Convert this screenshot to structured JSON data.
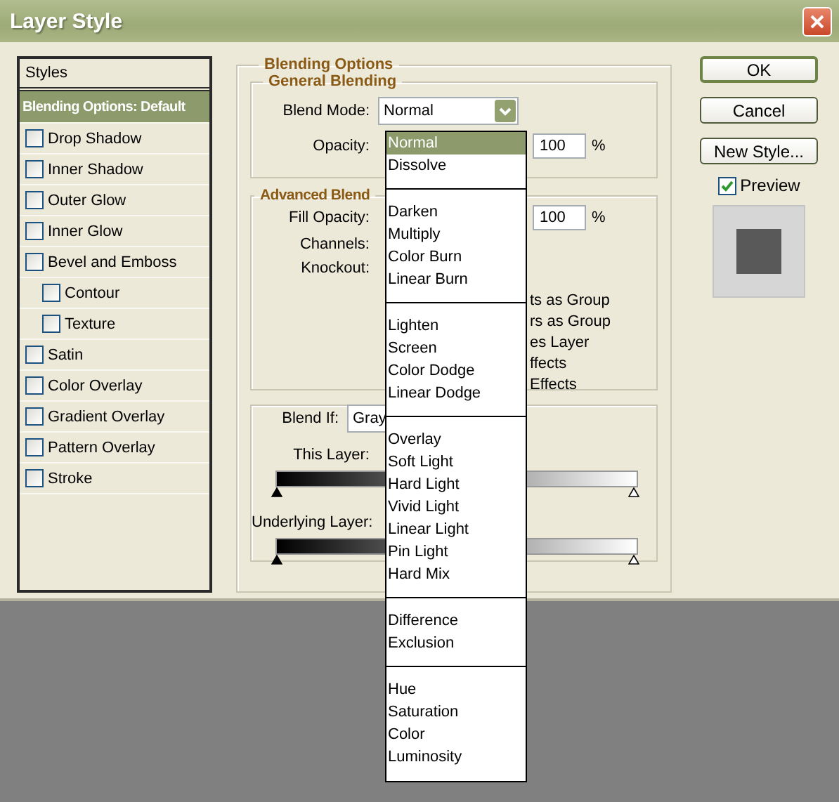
{
  "window": {
    "title": "Layer Style"
  },
  "styles_list": {
    "header": "Styles",
    "items": [
      {
        "label": "Blending Options: Default",
        "kind": "heading",
        "selected": true
      },
      {
        "label": "Drop Shadow",
        "kind": "checkbox",
        "checked": false,
        "selected": false
      },
      {
        "label": "Inner Shadow",
        "kind": "checkbox",
        "checked": false,
        "selected": false
      },
      {
        "label": "Outer Glow",
        "kind": "checkbox",
        "checked": false,
        "selected": false
      },
      {
        "label": "Inner Glow",
        "kind": "checkbox",
        "checked": false,
        "selected": false
      },
      {
        "label": "Bevel and Emboss",
        "kind": "checkbox",
        "checked": false,
        "selected": false,
        "children": [
          {
            "label": "Contour",
            "kind": "checkbox",
            "checked": false,
            "selected": false
          },
          {
            "label": "Texture",
            "kind": "checkbox",
            "checked": false,
            "selected": false
          }
        ]
      },
      {
        "label": "Satin",
        "kind": "checkbox",
        "checked": false,
        "selected": false
      },
      {
        "label": "Color Overlay",
        "kind": "checkbox",
        "checked": false,
        "selected": false
      },
      {
        "label": "Gradient Overlay",
        "kind": "checkbox",
        "checked": false,
        "selected": false
      },
      {
        "label": "Pattern Overlay",
        "kind": "checkbox",
        "checked": false,
        "selected": false
      },
      {
        "label": "Stroke",
        "kind": "checkbox",
        "checked": false,
        "selected": false
      }
    ]
  },
  "blending_options": {
    "title": "Blending Options",
    "general": {
      "title": "General Blending",
      "blend_mode_label": "Blend Mode:",
      "blend_mode": "Normal",
      "opacity_label": "Opacity:",
      "opacity": "100",
      "unit": "%"
    },
    "advanced": {
      "title": "Advanced Blend",
      "fill_opacity_label": "Fill Opacity:",
      "fill_opacity": "100",
      "unit": "%",
      "channels_label": "Channels:",
      "knockout_label": "Knockout:",
      "partial_options": [
        "ts as Group",
        "rs as Group",
        "es Layer",
        "ffects",
        "Effects"
      ]
    },
    "blend_if": {
      "label": "Blend If:",
      "channel": "Gray",
      "this_layer_label": "This Layer:",
      "underlying_label": "Underlying Layer:"
    }
  },
  "blend_mode_menu": {
    "groups": [
      {
        "items": [
          {
            "label": "Normal",
            "selected": true
          },
          {
            "label": "Dissolve",
            "selected": false
          }
        ]
      },
      {
        "items": [
          {
            "label": "Darken",
            "selected": false
          },
          {
            "label": "Multiply",
            "selected": false
          },
          {
            "label": "Color Burn",
            "selected": false
          },
          {
            "label": "Linear Burn",
            "selected": false
          }
        ]
      },
      {
        "items": [
          {
            "label": "Lighten",
            "selected": false
          },
          {
            "label": "Screen",
            "selected": false
          },
          {
            "label": "Color Dodge",
            "selected": false
          },
          {
            "label": "Linear Dodge",
            "selected": false
          }
        ]
      },
      {
        "items": [
          {
            "label": "Overlay",
            "selected": false
          },
          {
            "label": "Soft Light",
            "selected": false
          },
          {
            "label": "Hard Light",
            "selected": false
          },
          {
            "label": "Vivid Light",
            "selected": false
          },
          {
            "label": "Linear Light",
            "selected": false
          },
          {
            "label": "Pin Light",
            "selected": false
          },
          {
            "label": "Hard Mix",
            "selected": false
          }
        ]
      },
      {
        "items": [
          {
            "label": "Difference",
            "selected": false
          },
          {
            "label": "Exclusion",
            "selected": false
          }
        ]
      },
      {
        "items": [
          {
            "label": "Hue",
            "selected": false
          },
          {
            "label": "Saturation",
            "selected": false
          },
          {
            "label": "Color",
            "selected": false
          },
          {
            "label": "Luminosity",
            "selected": false
          }
        ]
      }
    ]
  },
  "buttons": [
    {
      "label": "OK",
      "kind": "default"
    },
    {
      "label": "Cancel",
      "kind": "normal"
    },
    {
      "label": "New Style...",
      "kind": "normal"
    }
  ],
  "preview": {
    "label": "Preview",
    "checked": true
  }
}
